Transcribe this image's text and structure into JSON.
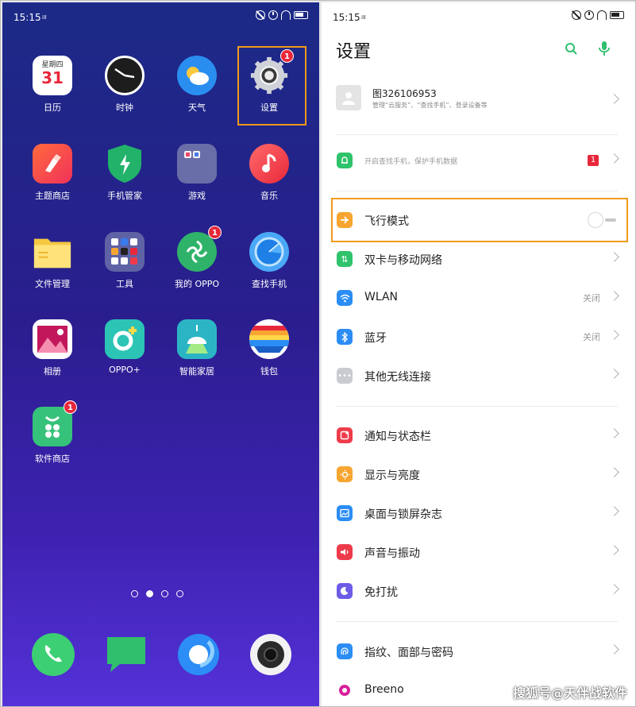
{
  "status_bar": {
    "time": "15:15",
    "signal": "ᵢₗₗ"
  },
  "home": {
    "apps": [
      {
        "label": "日历",
        "cal_weekday": "星期四",
        "cal_day": "31"
      },
      {
        "label": "时钟"
      },
      {
        "label": "天气"
      },
      {
        "label": "设置",
        "badge": "1"
      },
      {
        "label": "主题商店"
      },
      {
        "label": "手机管家"
      },
      {
        "label": "游戏"
      },
      {
        "label": "音乐"
      },
      {
        "label": "文件管理"
      },
      {
        "label": "工具"
      },
      {
        "label": "我的 OPPO",
        "badge": "1"
      },
      {
        "label": "查找手机"
      },
      {
        "label": "相册"
      },
      {
        "label": "OPPO+"
      },
      {
        "label": "智能家居"
      },
      {
        "label": "钱包"
      },
      {
        "label": "软件商店",
        "badge": "1"
      }
    ],
    "page_indicator": {
      "count": 4,
      "active": 2
    },
    "dock": [
      "phone",
      "messages",
      "browser",
      "camera"
    ]
  },
  "settings": {
    "title": "设置",
    "account": {
      "name": "图326106953",
      "desc": "管理“云服务”、“查找手机”、登录设备等"
    },
    "find_phone": {
      "desc": "开启查找手机，保护手机数据",
      "badge": "1"
    },
    "items": [
      {
        "label": "飞行模式",
        "color": "#f7a531"
      },
      {
        "label": "双卡与移动网络",
        "color": "#2fc36b"
      },
      {
        "label": "WLAN",
        "value": "关闭",
        "color": "#2b8df5"
      },
      {
        "label": "蓝牙",
        "value": "关闭",
        "color": "#2b8df5"
      },
      {
        "label": "其他无线连接",
        "color": "#c8cbd0"
      },
      {
        "label": "通知与状态栏",
        "color": "#ee3b4a"
      },
      {
        "label": "显示与亮度",
        "color": "#f7a531"
      },
      {
        "label": "桌面与锁屏杂志",
        "color": "#2b8df5"
      },
      {
        "label": "声音与振动",
        "color": "#ee3b4a"
      },
      {
        "label": "免打扰",
        "color": "#6c5ce7"
      },
      {
        "label": "指纹、面部与密码",
        "color": "#2b8df5"
      },
      {
        "label": "Breeno",
        "color": "#d8209a"
      }
    ],
    "highlight_color": "#f29a1a"
  },
  "watermark": "搜狐号@天伴战软件"
}
